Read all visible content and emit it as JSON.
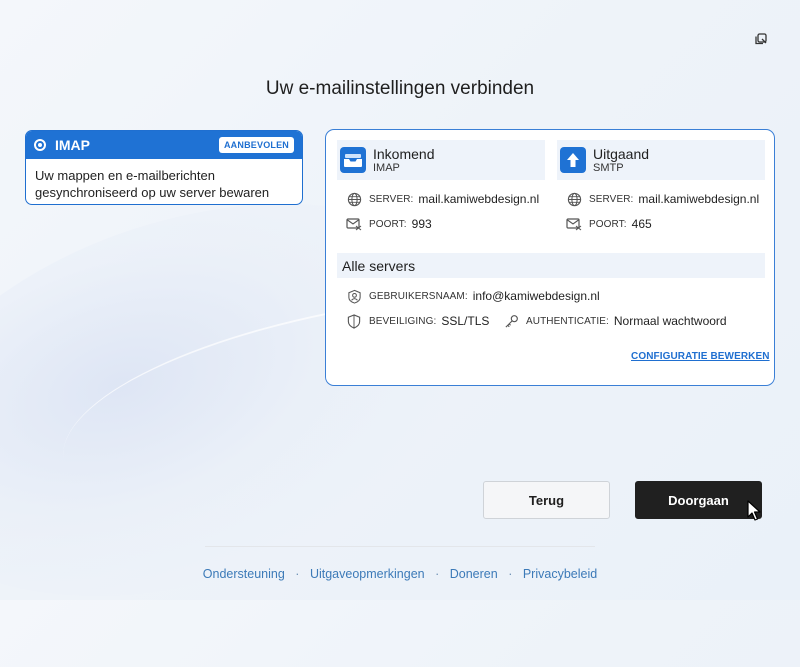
{
  "window": {
    "restore_icon": "restore-window-icon"
  },
  "page": {
    "title": "Uw e-mailinstellingen verbinden"
  },
  "imap_option": {
    "label": "IMAP",
    "badge": "AANBEVOLEN",
    "description_line1": "Uw mappen en e-mailberichten",
    "description_line2": "gesynchroniseerd op uw server bewaren",
    "selected": true,
    "accent_color": "#1f72d4"
  },
  "incoming": {
    "title": "Inkomend",
    "protocol": "IMAP",
    "icon": "inbox-tray-icon",
    "server_label": "SERVER:",
    "server": "mail.kamiwebdesign.nl",
    "port_label": "POORT:",
    "port": "993"
  },
  "outgoing": {
    "title": "Uitgaand",
    "protocol": "SMTP",
    "icon": "upload-arrow-icon",
    "server_label": "SERVER:",
    "server": "mail.kamiwebdesign.nl",
    "port_label": "POORT:",
    "port": "465"
  },
  "all_servers": {
    "title": "Alle servers",
    "username_label": "GEBRUIKERSNAAM:",
    "username": "info@kamiwebdesign.nl",
    "security_label": "BEVEILIGING:",
    "security": "SSL/TLS",
    "auth_label": "AUTHENTICATIE:",
    "auth": "Normaal wachtwoord"
  },
  "edit_config_link": "CONFIGURATIE BEWERKEN",
  "buttons": {
    "back": "Terug",
    "continue": "Doorgaan"
  },
  "footer": {
    "links": [
      "Ondersteuning",
      "Uitgaveopmerkingen",
      "Doneren",
      "Privacybeleid"
    ],
    "separator": "·"
  }
}
